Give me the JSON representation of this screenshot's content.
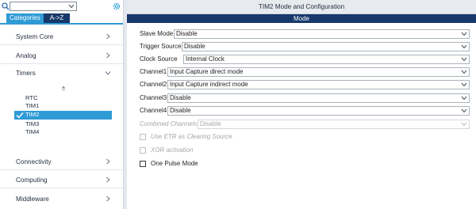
{
  "left_panel": {
    "search": {
      "value": "",
      "placeholder": ""
    },
    "tabs": {
      "categories": "Categories",
      "az": "A->Z"
    },
    "categories": {
      "system_core": "System Core",
      "analog": "Analog",
      "timers": "Timers",
      "connectivity": "Connectivity",
      "computing": "Computing",
      "middleware": "Middleware"
    },
    "timers": [
      "RTC",
      "TIM1",
      "TIM2",
      "TIM3",
      "TIM4"
    ],
    "selected_timer": "TIM2"
  },
  "right_panel": {
    "title": "TIM2 Mode and Configuration",
    "section": "Mode",
    "fields": {
      "slave_mode": {
        "label": "Slave Mode",
        "value": "Disable"
      },
      "trigger_source": {
        "label": "Trigger Source",
        "value": "Disable"
      },
      "clock_source": {
        "label": "Clock Source",
        "value": "Internal Clock"
      },
      "channel1": {
        "label": "Channel1",
        "value": "Input Capture direct mode"
      },
      "channel2": {
        "label": "Channel2",
        "value": "Input Capture indirect mode"
      },
      "channel3": {
        "label": "Channel3",
        "value": "Disable"
      },
      "channel4": {
        "label": "Channel4",
        "value": "Disable"
      },
      "combined_channels": {
        "label": "Combined Channels",
        "value": "Disable"
      }
    },
    "checks": {
      "use_etr": "Use ETR as Clearing Source",
      "xor": "XOR activation",
      "one_pulse": "One Pulse Mode"
    }
  },
  "colors": {
    "accent": "#2f9bd5",
    "navy": "#17386a",
    "disabled_text": "#a7a7a7"
  }
}
